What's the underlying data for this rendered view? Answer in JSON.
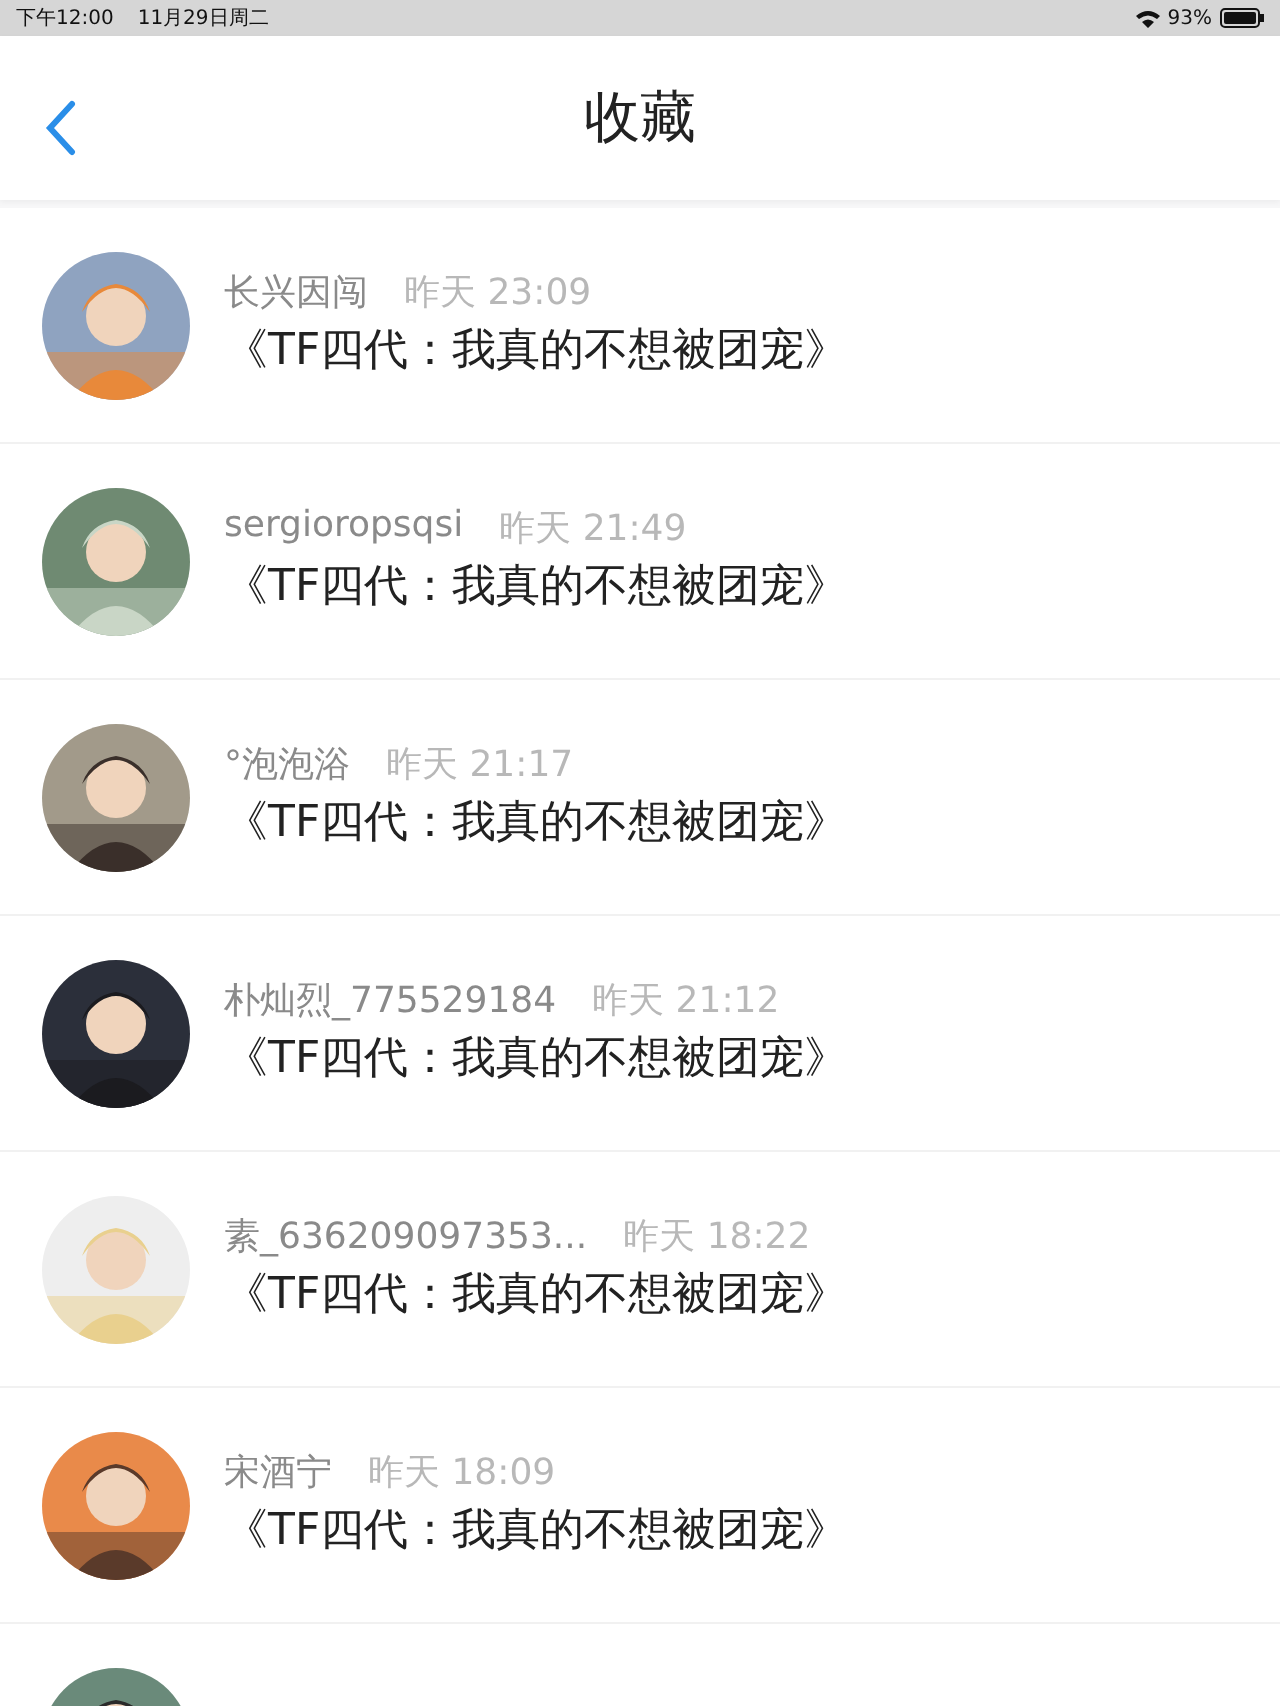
{
  "status_bar": {
    "time": "下午12:00",
    "date": "11月29日周二",
    "battery": "93%"
  },
  "nav": {
    "title": "收藏"
  },
  "items": [
    {
      "name": "长兴因闯",
      "time": "昨天 23:09",
      "title": "《TF四代：我真的不想被团宠》",
      "avatar": {
        "kind": "picture"
      }
    },
    {
      "name": "sergioropsqsi",
      "time": "昨天 21:49",
      "title": "《TF四代：我真的不想被团宠》",
      "avatar": {
        "kind": "picture"
      }
    },
    {
      "name": "°泡泡浴",
      "time": "昨天 21:17",
      "title": "《TF四代：我真的不想被团宠》",
      "avatar": {
        "kind": "picture"
      }
    },
    {
      "name": "朴灿烈_775529184",
      "time": "昨天 21:12",
      "title": "《TF四代：我真的不想被团宠》",
      "avatar": {
        "kind": "picture"
      }
    },
    {
      "name": "素_636209097353...",
      "time": "昨天 18:22",
      "title": "《TF四代：我真的不想被团宠》",
      "avatar": {
        "kind": "picture"
      }
    },
    {
      "name": "宋酒宁",
      "time": "昨天 18:09",
      "title": "《TF四代：我真的不想被团宠》",
      "avatar": {
        "kind": "picture"
      }
    },
    {
      "avatar": {
        "kind": "picture"
      }
    }
  ]
}
